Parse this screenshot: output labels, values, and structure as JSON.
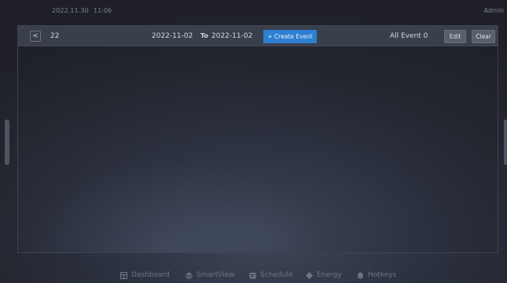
{
  "header": {
    "date": "2022.11.30",
    "time": "11:06",
    "user": "Admin"
  },
  "toolbar": {
    "back_glyph": "<",
    "number": "22",
    "date_from": "2022-11-02",
    "to_label": "To",
    "date_to": "2022-11-02",
    "create_label": "+  Create Event",
    "all_events": "All Event 0",
    "edit_label": "Edit",
    "clear_label": "Clear"
  },
  "nav": [
    {
      "label": "Dashboard",
      "icon": "dashboard-icon"
    },
    {
      "label": "SmartView",
      "icon": "smartview-icon"
    },
    {
      "label": "Schedule",
      "icon": "schedule-icon"
    },
    {
      "label": "Energy",
      "icon": "energy-icon"
    },
    {
      "label": "Hotkeys",
      "icon": "hotkeys-icon"
    }
  ],
  "colors": {
    "accent": "#2d7fd1",
    "background": "#24262f"
  }
}
